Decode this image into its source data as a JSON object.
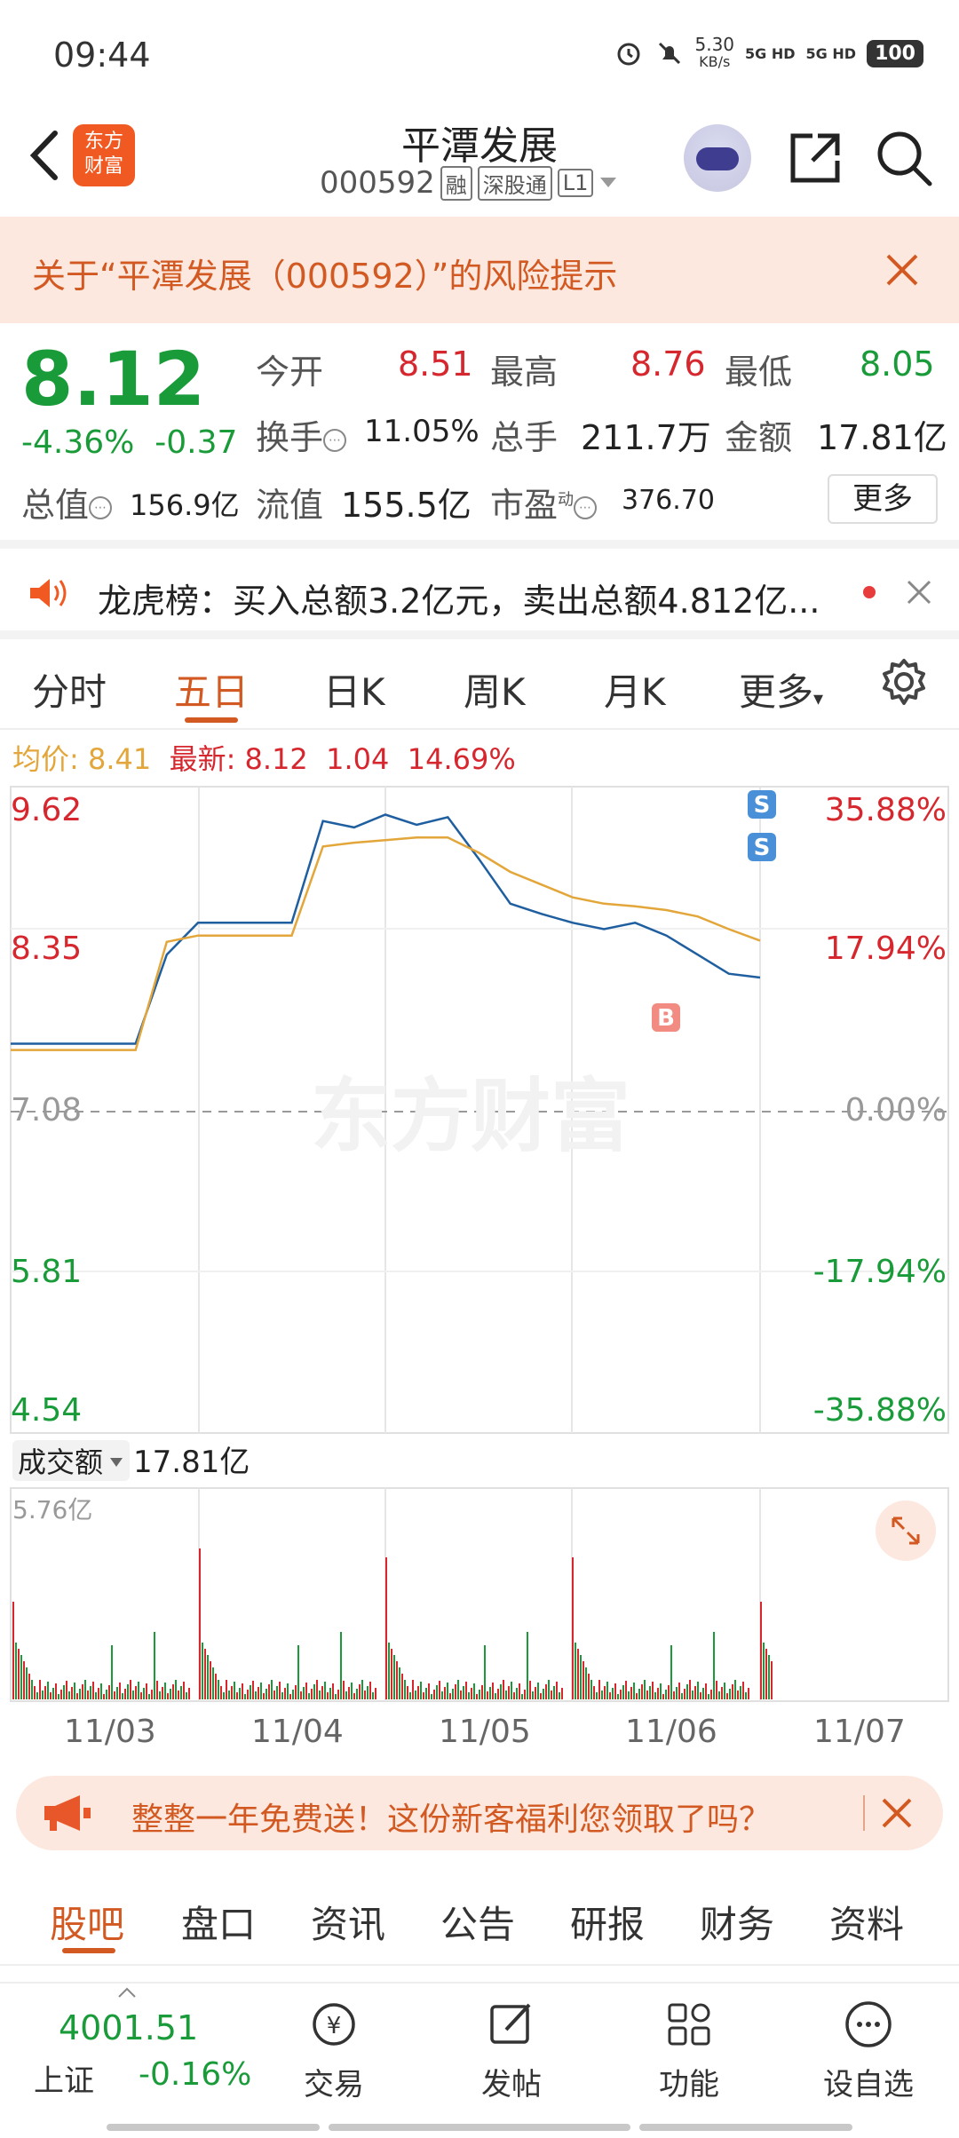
{
  "status_bar": {
    "time": "09:44",
    "speed": "5.30",
    "speed_unit": "KB/s",
    "net1": "5G HD",
    "net2": "5G HD",
    "battery": "100"
  },
  "header": {
    "logo_line1": "东方",
    "logo_line2": "财富",
    "stock_name": "平潭发展",
    "stock_code": "000592",
    "tags": [
      "融",
      "深股通",
      "L1"
    ]
  },
  "risk_banner": {
    "text": "关于“平潭发展（000592）”的风险提示"
  },
  "quote": {
    "price": "8.12",
    "change_pct": "-4.36%",
    "change_amt": "-0.37",
    "open_label": "今开",
    "open": "8.51",
    "high_label": "最高",
    "high": "8.76",
    "low_label": "最低",
    "low": "8.05",
    "turnover_label": "换手",
    "turnover": "11.05%",
    "volume_label": "总手",
    "volume": "211.7万",
    "amount_label": "金额",
    "amount": "17.81亿",
    "mktcap_label": "总值",
    "mktcap": "156.9亿",
    "float_label": "流值",
    "float": "155.5亿",
    "pe_label": "市盈",
    "pe_sup": "动",
    "pe": "376.70",
    "more_label": "更多"
  },
  "lhb": {
    "text": "龙虎榜：买入总额3.2亿元，卖出总额4.812亿..."
  },
  "chart_tabs": {
    "items": [
      "分时",
      "五日",
      "日K",
      "周K",
      "月K",
      "更多"
    ],
    "active": "五日"
  },
  "chart_header": {
    "avg_label": "均价:",
    "avg_value": "8.41",
    "latest_label": "最新:",
    "latest_value": "8.12",
    "latest_change": "1.04",
    "latest_pct": "14.69%"
  },
  "chart_data": {
    "type": "line",
    "title": "",
    "y_left_ticks": [
      "9.62",
      "8.35",
      "7.08",
      "5.81",
      "4.54"
    ],
    "y_right_ticks": [
      "35.88%",
      "17.94%",
      "0.00%",
      "-17.94%",
      "-35.88%"
    ],
    "ylim": [
      4.54,
      9.62
    ],
    "reference_price": 7.08,
    "x_categories": [
      "11/03",
      "11/04",
      "11/05",
      "11/06",
      "11/07"
    ],
    "series": [
      {
        "color": "#1f5fa0",
        "values": [
          7.6,
          7.6,
          7.6,
          7.6,
          7.6,
          8.3,
          8.55,
          8.55,
          8.55,
          8.55,
          9.35,
          9.3,
          9.4,
          9.32,
          9.38,
          9.05,
          8.7,
          8.62,
          8.55,
          8.5,
          8.55,
          8.45,
          8.3,
          8.15,
          8.12
        ]
      },
      {
        "color": "#e3a63a",
        "values": [
          7.55,
          7.55,
          7.55,
          7.55,
          7.55,
          8.4,
          8.45,
          8.45,
          8.45,
          8.45,
          9.15,
          9.18,
          9.2,
          9.22,
          9.22,
          9.1,
          8.95,
          8.85,
          8.75,
          8.7,
          8.68,
          8.65,
          8.6,
          8.5,
          8.41
        ]
      }
    ],
    "markers": [
      {
        "label": "S",
        "color": "#4a90d9"
      },
      {
        "label": "S",
        "color": "#4a90d9"
      },
      {
        "label": "B",
        "color": "#f28b82"
      }
    ],
    "watermark": "东方财富"
  },
  "volume": {
    "label": "成交额",
    "total": "17.81亿",
    "max_tick": "5.76亿"
  },
  "promo": {
    "text": "整整一年免费送！这份新客福利您领取了吗？"
  },
  "bottom_tabs": {
    "items": [
      "股吧",
      "盘口",
      "资讯",
      "公告",
      "研报",
      "财务",
      "资料"
    ],
    "active": "股吧"
  },
  "bottom_nav": {
    "index_value": "4001.51",
    "index_name": "上证",
    "index_change": "-0.16%",
    "items": [
      "交易",
      "发帖",
      "功能",
      "设自选"
    ]
  }
}
